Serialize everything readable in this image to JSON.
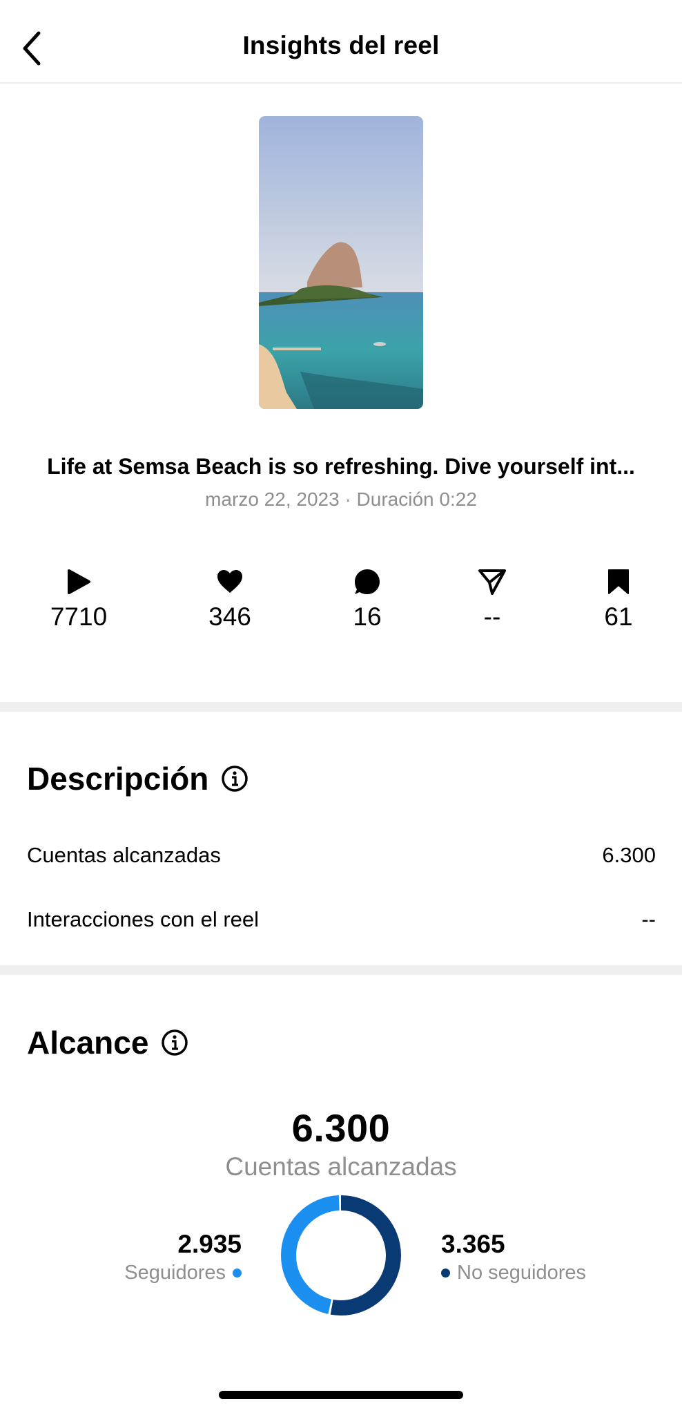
{
  "header": {
    "title": "Insights del reel"
  },
  "post": {
    "caption": "Life at Semsa Beach is so refreshing. Dive yourself int...",
    "meta": "marzo 22, 2023 · Duración 0:22"
  },
  "stats": [
    {
      "icon": "play-icon",
      "value": "7710"
    },
    {
      "icon": "heart-icon",
      "value": "346"
    },
    {
      "icon": "comment-icon",
      "value": "16"
    },
    {
      "icon": "share-icon",
      "value": "--"
    },
    {
      "icon": "bookmark-icon",
      "value": "61"
    }
  ],
  "description": {
    "title": "Descripción",
    "rows": [
      {
        "label": "Cuentas alcanzadas",
        "value": "6.300"
      },
      {
        "label": "Interacciones con el reel",
        "value": "--"
      }
    ]
  },
  "reach": {
    "title": "Alcance",
    "total": "6.300",
    "total_label": "Cuentas alcanzadas",
    "followers": {
      "value": "2.935",
      "label": "Seguidores",
      "count": 2935,
      "color": "#1b8ff0"
    },
    "non_followers": {
      "value": "3.365",
      "label": "No seguidores",
      "count": 3365,
      "color": "#0a3a74"
    }
  }
}
